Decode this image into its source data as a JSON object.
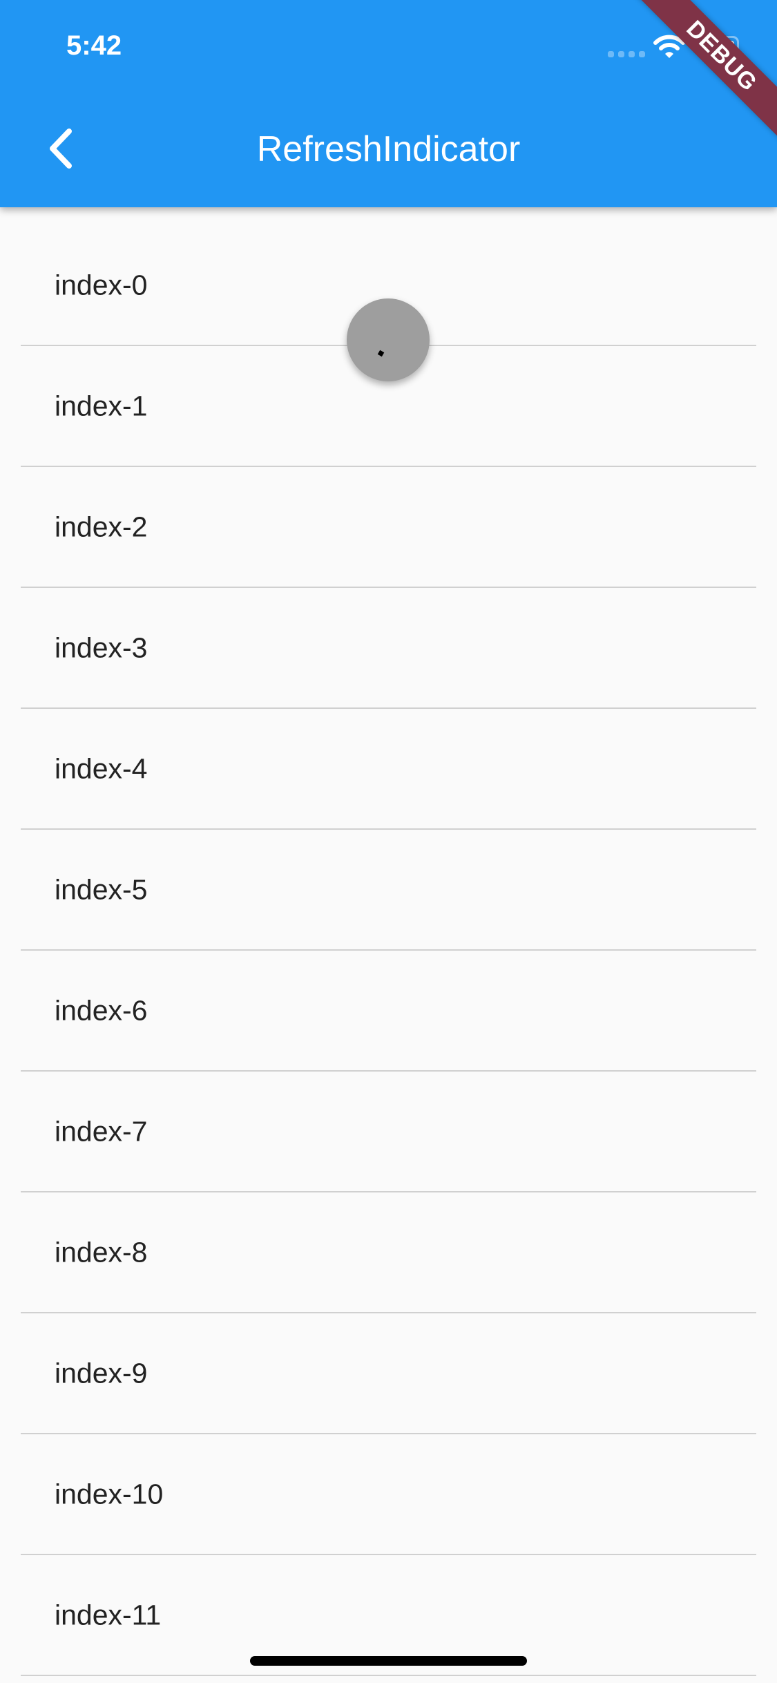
{
  "status_bar": {
    "time": "5:42"
  },
  "app_bar": {
    "title": "RefreshIndicator",
    "back_icon": "chevron-left-icon"
  },
  "debug_banner": "DEBUG",
  "list": {
    "items": [
      "index-0",
      "index-1",
      "index-2",
      "index-3",
      "index-4",
      "index-5",
      "index-6",
      "index-7",
      "index-8",
      "index-9",
      "index-10",
      "index-11"
    ]
  },
  "refresh_indicator": {
    "state": "pulling"
  }
}
